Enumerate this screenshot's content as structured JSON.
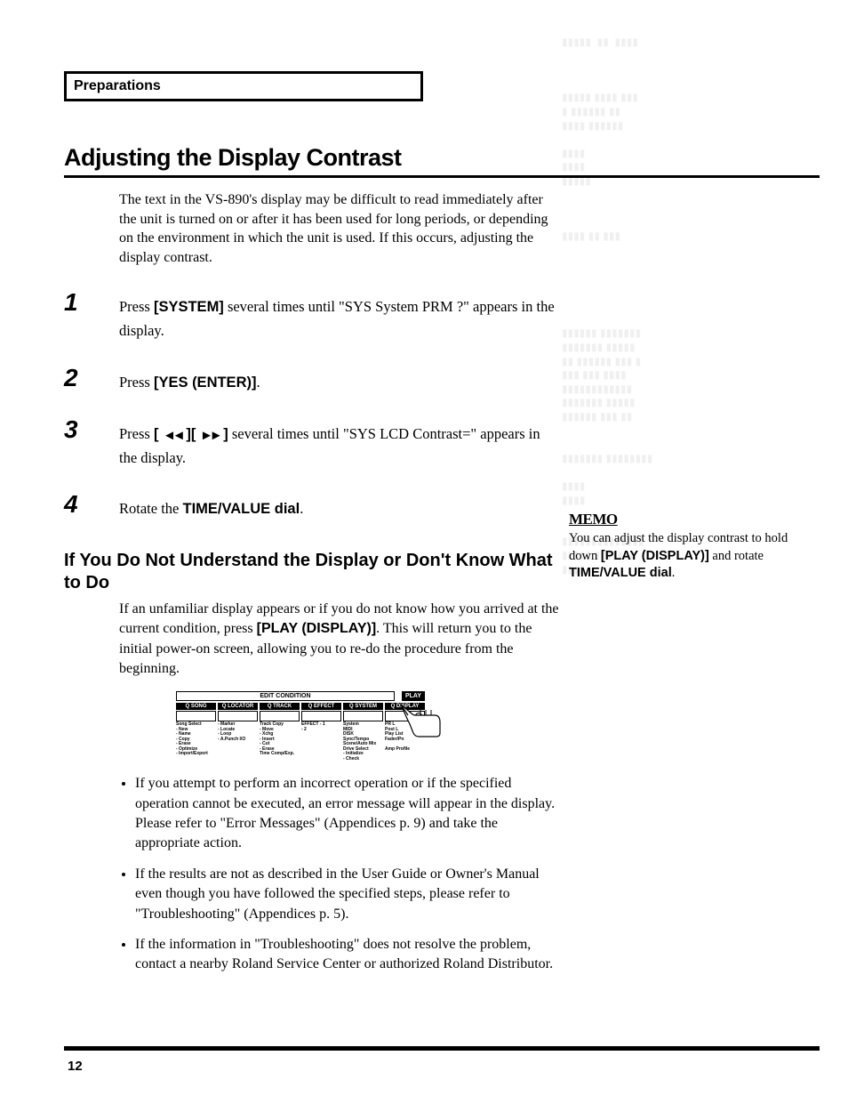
{
  "section_tab": "Preparations",
  "title": "Adjusting the Display Contrast",
  "intro": "The text in the VS-890's display may be difficult to read immediately after the unit is turned on or after it has been used for long periods, or depending on the environment in which the unit is used. If this occurs, adjusting the display contrast.",
  "steps": [
    {
      "num": "1",
      "pre": "Press ",
      "bold": "[SYSTEM]",
      "post": " several times until \"SYS System PRM ?\" appears in the display."
    },
    {
      "num": "2",
      "pre": "Press ",
      "bold": "[YES (ENTER)]",
      "post": "."
    },
    {
      "num": "3",
      "pre": "Press ",
      "bold_open": "[ ",
      "icon1": "◄◄",
      "bold_mid": " ][ ",
      "icon2": "►►",
      "bold_close": " ]",
      "post": " several times until \"SYS LCD Contrast=\" appears in the display."
    },
    {
      "num": "4",
      "pre": "Rotate the ",
      "bold": "TIME/VALUE dial",
      "post": "."
    }
  ],
  "subhead": "If You Do Not Understand the Display or Don't Know What to Do",
  "sub_body_pre": "If an unfamiliar display appears or if you do not know how you arrived at the current condition, press ",
  "sub_body_bold": "[PLAY (DISPLAY)]",
  "sub_body_post": ". This will return you to the initial power-on screen, allowing you to re-do the procedure from the beginning.",
  "diagram": {
    "edit_condition": "EDIT CONDITION",
    "play": "PLAY",
    "cols": [
      {
        "hdr": "Q SONG",
        "sub": "Song Select\n- New\n- Name\n- Copy\n- Erase\n- Optimize\n- Import/Export"
      },
      {
        "hdr": "Q LOCATOR",
        "sub": "- Marker\n- Locate\n- Loop\n- A.Punch I/O"
      },
      {
        "hdr": "Q TRACK",
        "sub": "Track Copy\n- Move\n- Xchg\n- Insert\n- Cut\n- Erase\nTime Comp/Exp."
      },
      {
        "hdr": "Q EFFECT",
        "sub": "EFFECT - 1\n          - 2"
      },
      {
        "hdr": "Q SYSTEM",
        "sub": "System\nMIDI\nDISK\nSync/Tempo\nScene/Auto Mix\nDrive Select\n- Initialize\n- Check"
      },
      {
        "hdr": "Q DISPLAY",
        "sub": "PR L\nPost L\nPlay List\nFader/Pn\n\nAmp Profile",
        "lit": true
      }
    ]
  },
  "bullets": [
    "If you attempt to perform an incorrect operation or if the specified operation cannot be executed, an error message will appear in the display. Please refer to \"Error Messages\" (Appendices p. 9) and take the appropriate action.",
    "If the results are not as described in the User Guide or Owner's Manual even though you have followed the specified steps, please refer to \"Troubleshooting\" (Appendices p. 5).",
    "If the information in \"Troubleshooting\" does not resolve the problem, contact a nearby Roland Service Center or authorized Roland Distributor."
  ],
  "memo": {
    "label": "MEMO",
    "body_pre": "You can adjust the display contrast to hold down ",
    "body_bold1": "[PLAY (DISPLAY)]",
    "body_mid": " and rotate ",
    "body_bold2": "TIME/VALUE dial",
    "body_post": "."
  },
  "page_number": "12",
  "ghost": "▮▮▮▮▮  ▮▮  ▮▮▮▮\n\n\n\n▮▮▮▮▮ ▮▮▮▮ ▮▮▮\n▮ ▮▮▮▮▮▮ ▮▮\n▮▮▮▮ ▮▮▮▮▮▮\n\n▮▮▮▮\n▮▮▮▮\n▮▮▮▮▮\n\n\n\n▮▮▮▮ ▮▮ ▮▮▮\n\n\n\n\n\n\n▮▮▮▮▮▮ ▮▮▮▮▮▮▮\n▮▮▮▮▮▮▮ ▮▮▮▮▮\n▮▮ ▮▮▮▮▮▮ ▮▮▮ ▮\n▮▮▮ ▮▮▮ ▮▮▮▮\n▮▮▮▮▮▮▮▮▮▮▮▮\n▮▮▮▮▮▮▮ ▮▮▮▮▮\n▮▮▮▮▮▮ ▮▮▮ ▮▮\n\n\n▮▮▮▮▮▮▮ ▮▮▮▮▮▮▮▮\n\n▮▮▮▮\n▮▮▮▮\n\n\n▮▮▮▮▮▮▮▮▮▮▮▮▮▮\n▮▮▮▮▮ ▮▮▮▮▮▮▮\n▮▮▮▮"
}
